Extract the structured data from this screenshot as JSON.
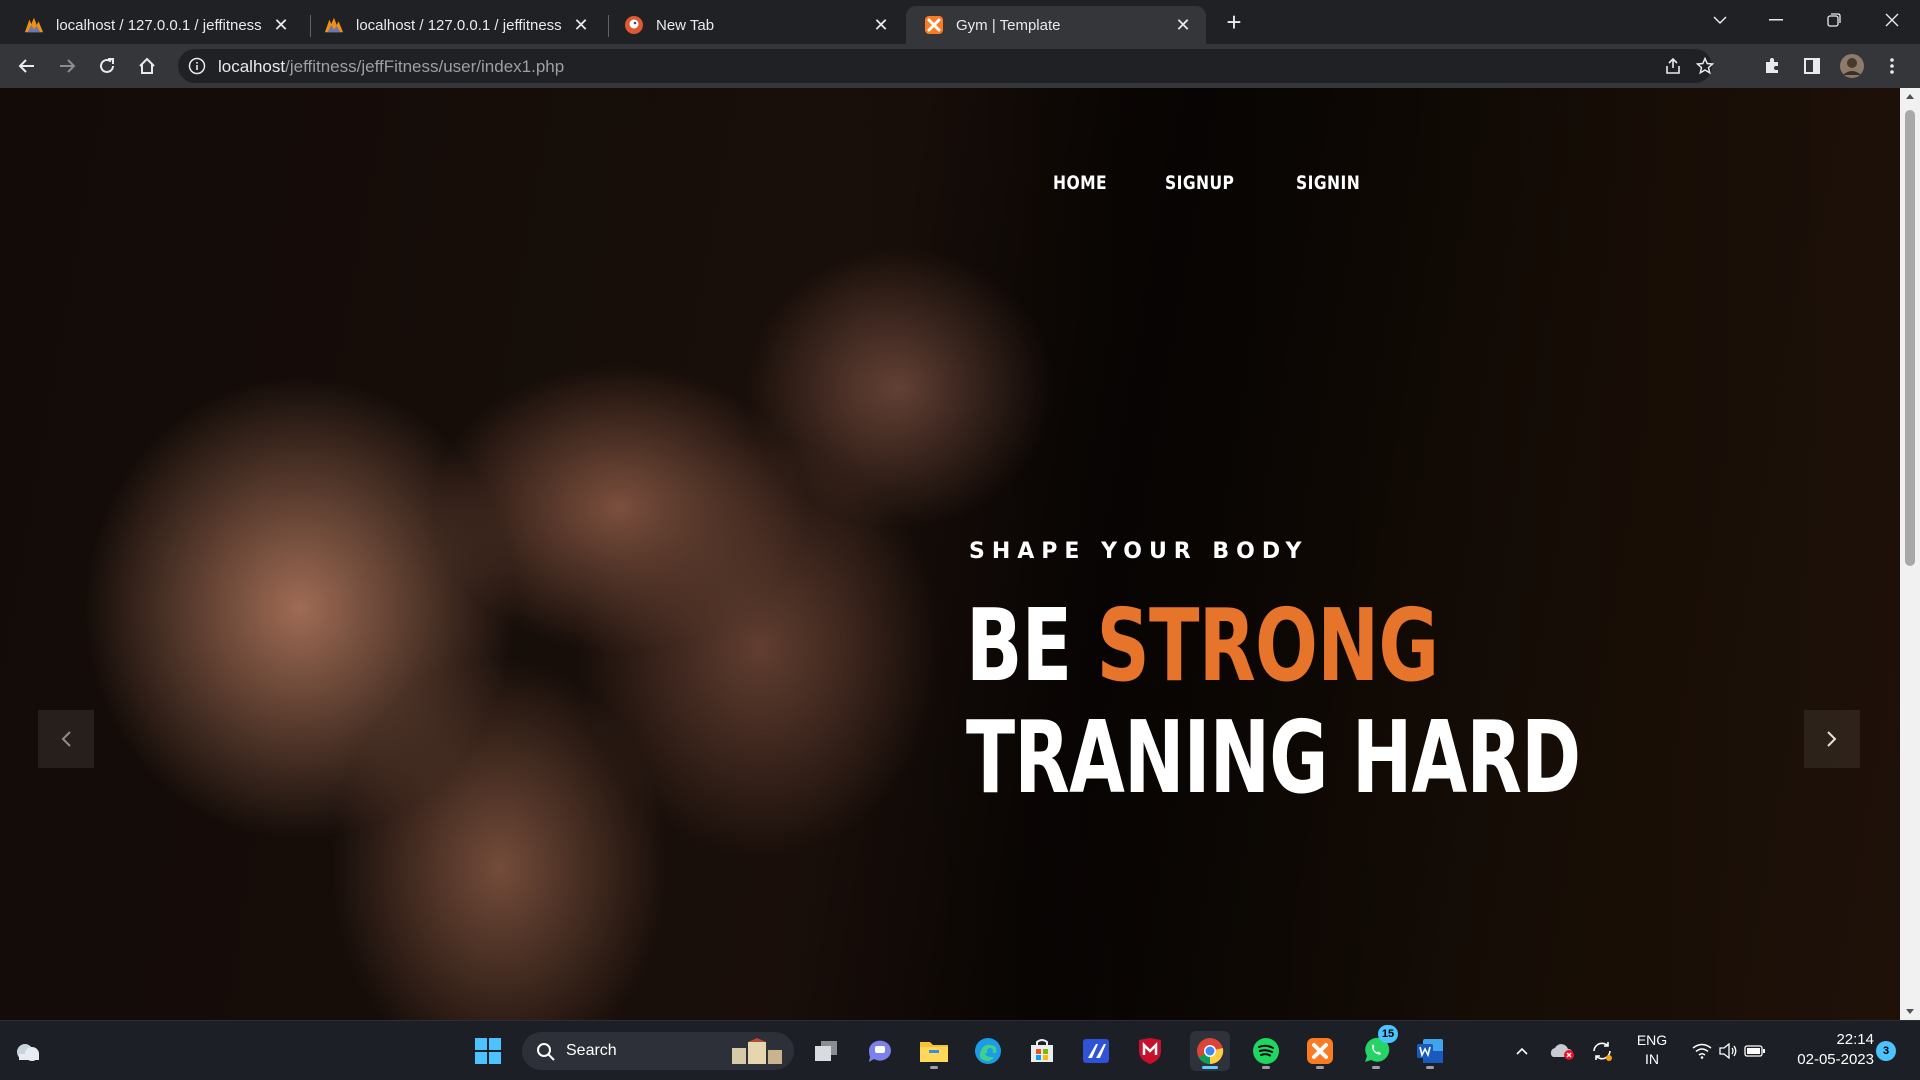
{
  "browser": {
    "tabs": [
      {
        "title": "localhost / 127.0.0.1 / jeffitness",
        "icon": "phpmyadmin-icon",
        "active": false
      },
      {
        "title": "localhost / 127.0.0.1 / jeffitness",
        "icon": "phpmyadmin-icon",
        "active": false
      },
      {
        "title": "New Tab",
        "icon": "duckduckgo-icon",
        "active": false
      },
      {
        "title": "Gym | Template",
        "icon": "xampp-icon",
        "active": true
      }
    ],
    "url_host": "localhost",
    "url_path": "/jeffitness/jeffFitness/user/index1.php"
  },
  "page": {
    "nav": [
      "HOME",
      "SIGNUP",
      "SIGNIN"
    ],
    "subtitle": "SHAPE YOUR BODY",
    "headline_part1": "BE",
    "headline_accent": "STRONG",
    "headline_line2": "TRANING HARD",
    "accent_color": "#e6742b"
  },
  "taskbar": {
    "search_label": "Search",
    "language_line1": "ENG",
    "language_line2": "IN",
    "time": "22:14",
    "date": "02-05-2023",
    "whatsapp_badge": "15",
    "notification_count": "3"
  }
}
